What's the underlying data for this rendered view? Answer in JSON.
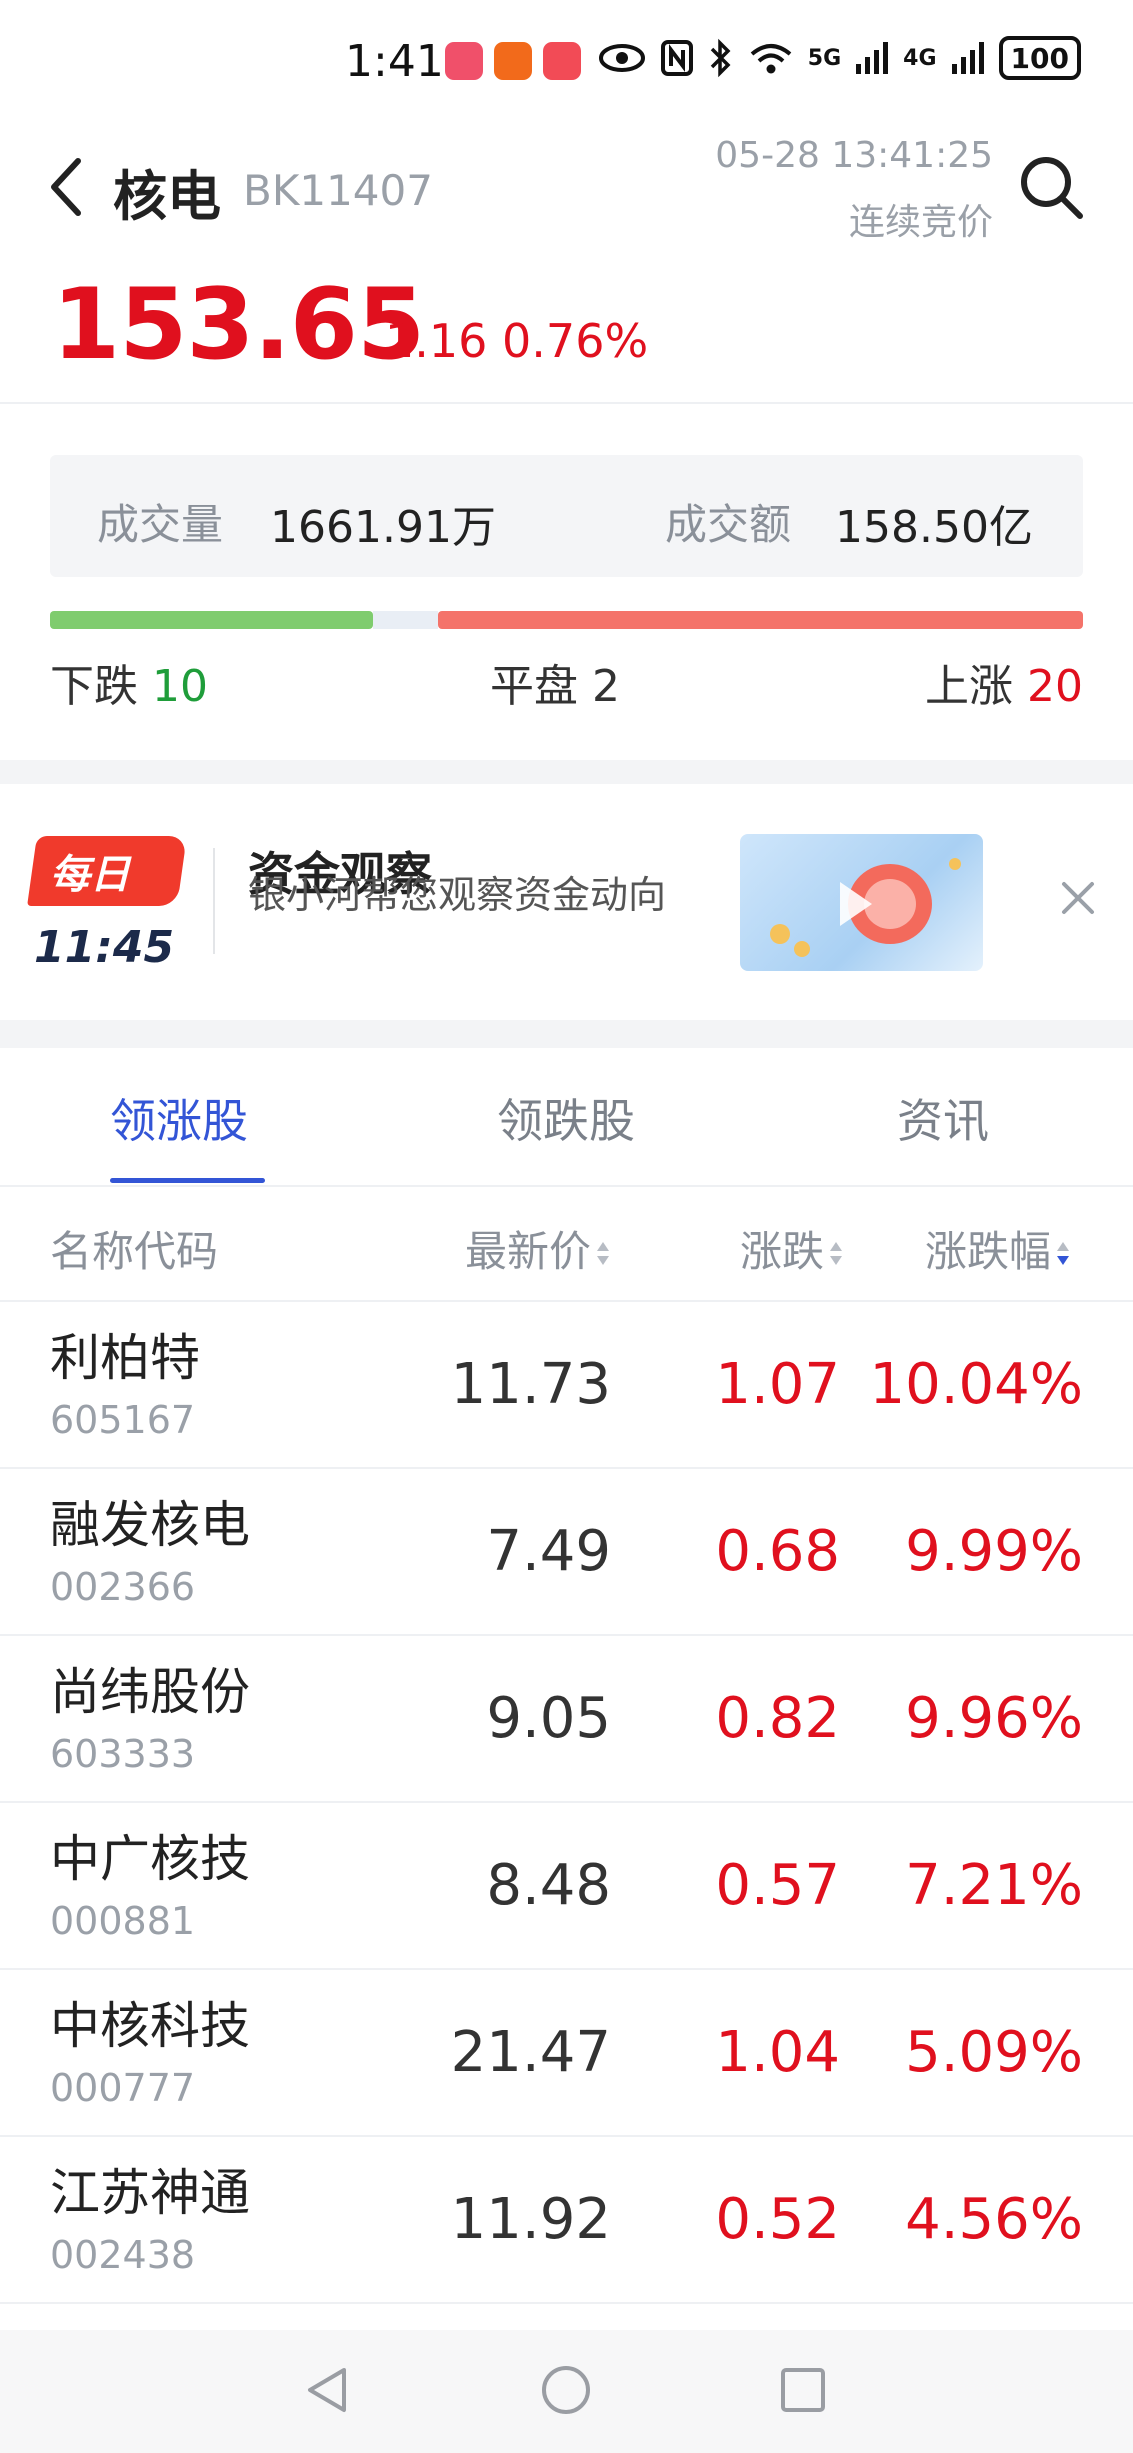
{
  "status_bar": {
    "time": "1:41",
    "network_5g": "5G",
    "network_4g": "4G",
    "battery": "100",
    "icons": [
      "eye-icon",
      "nfc-icon",
      "bluetooth-icon",
      "wifi-icon",
      "signal-icon"
    ]
  },
  "header": {
    "title": "核电",
    "code": "BK11407",
    "datetime": "05-28 13:41:25",
    "phase": "连续竞价",
    "price": "153.65",
    "change": "1.16 0.76%"
  },
  "volume": {
    "vol_label": "成交量",
    "vol_value": "1661.91万",
    "amt_label": "成交额",
    "amt_value": "158.50亿"
  },
  "breadth": {
    "down_label": "下跌",
    "down_count": "10",
    "flat_label": "平盘",
    "flat_count": "2",
    "up_label": "上涨",
    "up_count": "20",
    "down": 10,
    "flat": 2,
    "up": 20
  },
  "ad": {
    "logo_text": "每日",
    "time": "11:45",
    "title": "资金观察",
    "subtitle": "银小河帮您观察资金动向"
  },
  "tabs": [
    {
      "label": "领涨股",
      "active": true
    },
    {
      "label": "领跌股",
      "active": false
    },
    {
      "label": "资讯",
      "active": false
    }
  ],
  "table": {
    "headers": {
      "name": "名称代码",
      "price": "最新价",
      "change": "涨跌",
      "pct": "涨跌幅"
    },
    "rows": [
      {
        "name": "利柏特",
        "code": "605167",
        "price": "11.73",
        "change": "1.07",
        "pct": "10.04%"
      },
      {
        "name": "融发核电",
        "code": "002366",
        "price": "7.49",
        "change": "0.68",
        "pct": "9.99%"
      },
      {
        "name": "尚纬股份",
        "code": "603333",
        "price": "9.05",
        "change": "0.82",
        "pct": "9.96%"
      },
      {
        "name": "中广核技",
        "code": "000881",
        "price": "8.48",
        "change": "0.57",
        "pct": "7.21%"
      },
      {
        "name": "中核科技",
        "code": "000777",
        "price": "21.47",
        "change": "1.04",
        "pct": "5.09%"
      },
      {
        "name": "江苏神通",
        "code": "002438",
        "price": "11.92",
        "change": "0.52",
        "pct": "4.56%"
      }
    ]
  },
  "colors": {
    "up_red": "#e0101e",
    "down_green": "#1f9d3a",
    "accent_blue": "#3355d6"
  }
}
